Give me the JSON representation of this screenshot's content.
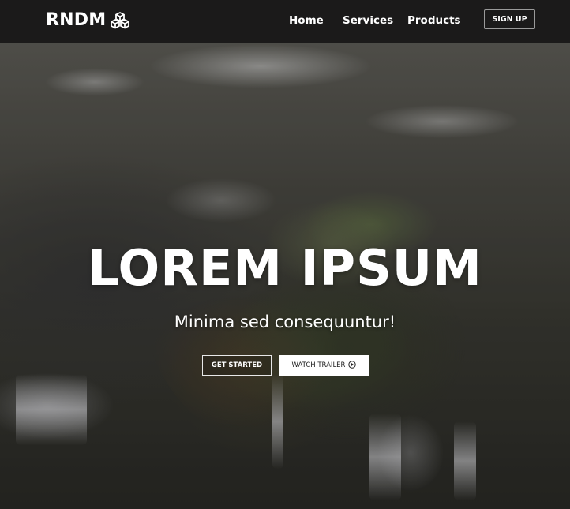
{
  "nav": {
    "brand": "RNDM",
    "brand_icon": "cubes-icon",
    "links": [
      "Home",
      "Services",
      "Products"
    ],
    "signup_label": "SIGN UP"
  },
  "hero": {
    "title": "LOREM IPSUM",
    "subtitle": "Minima sed consequuntur!",
    "primary_button": "GET STARTED",
    "secondary_button": "WATCH TRAILER",
    "secondary_icon": "play-circle-icon"
  },
  "colors": {
    "navbar_bg": "#1b1a1a",
    "text": "#ffffff",
    "button_bg": "#ffffff"
  }
}
